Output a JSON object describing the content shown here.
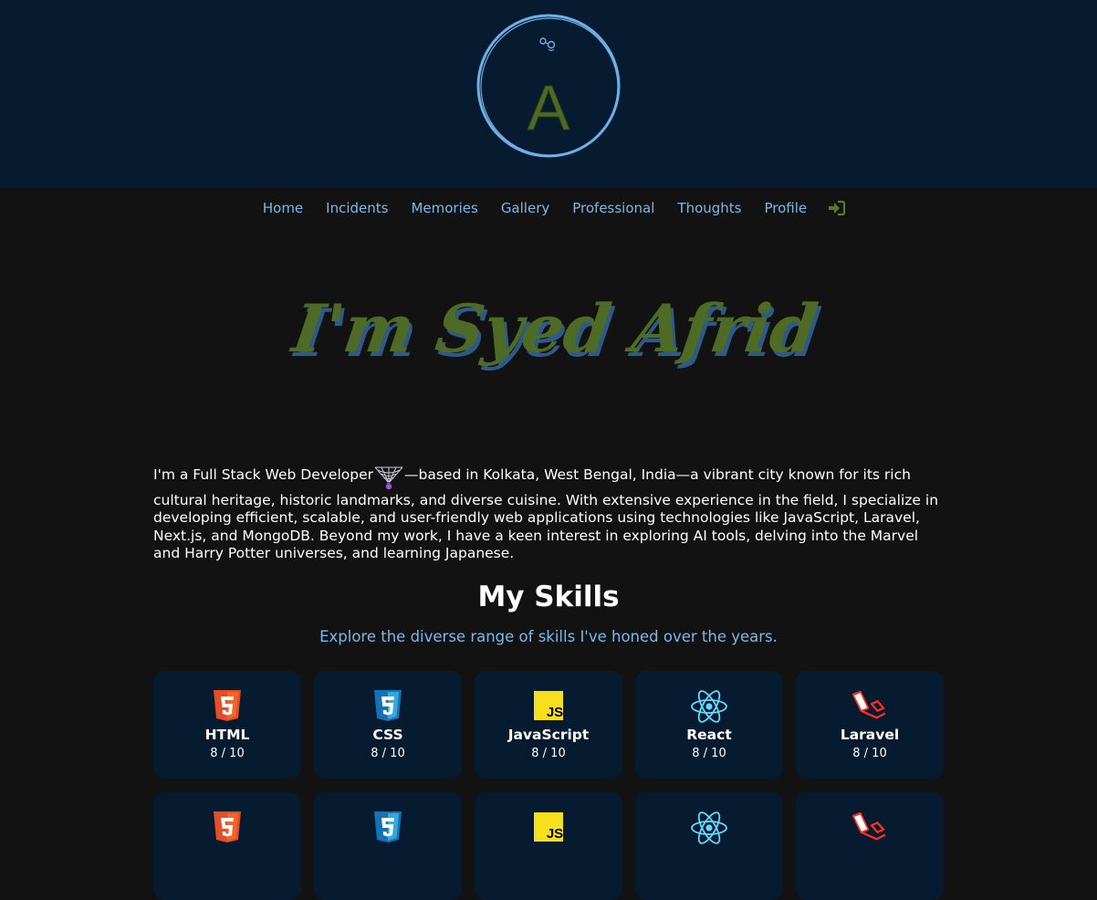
{
  "header": {
    "logo_letter": "A"
  },
  "nav": {
    "items": [
      "Home",
      "Incidents",
      "Memories",
      "Gallery",
      "Professional",
      "Thoughts",
      "Profile"
    ],
    "login_icon": "sign-in-icon"
  },
  "hero": {
    "title": "I'm Syed Afrid"
  },
  "intro": {
    "before_icon": "I'm a Full Stack Web Developer",
    "icon": "spider-web-icon",
    "after_icon": "—based in Kolkata, West Bengal, India—a vibrant city known for its rich cultural heritage, historic landmarks, and diverse cuisine. With extensive experience in the field, I specialize in developing efficient, scalable, and user-friendly web applications using technologies like JavaScript, Laravel, Next.js, and MongoDB. Beyond my work, I have a keen interest in exploring AI tools, delving into the Marvel and Harry Potter universes, and learning Japanese."
  },
  "skills": {
    "title": "My Skills",
    "subtitle": "Explore the diverse range of skills I've honed over the years.",
    "items": [
      {
        "name": "HTML",
        "level": "8 / 10",
        "icon": "html5-icon"
      },
      {
        "name": "CSS",
        "level": "8 / 10",
        "icon": "css3-icon"
      },
      {
        "name": "JavaScript",
        "level": "8 / 10",
        "icon": "javascript-icon"
      },
      {
        "name": "React",
        "level": "8 / 10",
        "icon": "react-icon"
      },
      {
        "name": "Laravel",
        "level": "8 / 10",
        "icon": "laravel-icon"
      }
    ]
  },
  "colors": {
    "header_bg": "#061a30",
    "page_bg": "#121212",
    "accent_blue": "#7ab9e8",
    "accent_green": "#4e6b26"
  }
}
